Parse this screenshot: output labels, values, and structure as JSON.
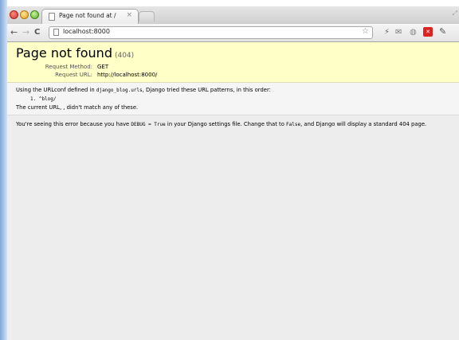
{
  "browser": {
    "tab_title": "Page not found at /",
    "tab_close": "×",
    "address": "localhost:8000",
    "back": "←",
    "forward": "→",
    "reload": "C",
    "star": "☆",
    "wrench": "🔧",
    "ext_icons": [
      "bolt-extension-icon",
      "gmail-icon",
      "shield-extension-icon",
      "red-x-extension-icon"
    ]
  },
  "page": {
    "title": "Page not found",
    "status_code": "(404)",
    "request_method_label": "Request Method:",
    "request_method": "GET",
    "request_url_label": "Request URL:",
    "request_url": "http://localhost:8000/",
    "urlconf_prefix": "Using the URLconf defined in ",
    "urlconf_module": "django_blog.urls",
    "urlconf_suffix": ", Django tried these URL patterns, in this order:",
    "patterns": [
      "1. ^blog/"
    ],
    "no_match_text": "The current URL, , didn't match any of these.",
    "explanation_prefix": "You're seeing this error because you have ",
    "debug_setting": "DEBUG = True",
    "explanation_middle": " in your Django settings file. Change that to ",
    "false_value": "False",
    "explanation_suffix": ", and Django will display a standard 404 page."
  },
  "colors": {
    "summary_bg": "#ffffc8",
    "content_bg": "#ededed"
  }
}
